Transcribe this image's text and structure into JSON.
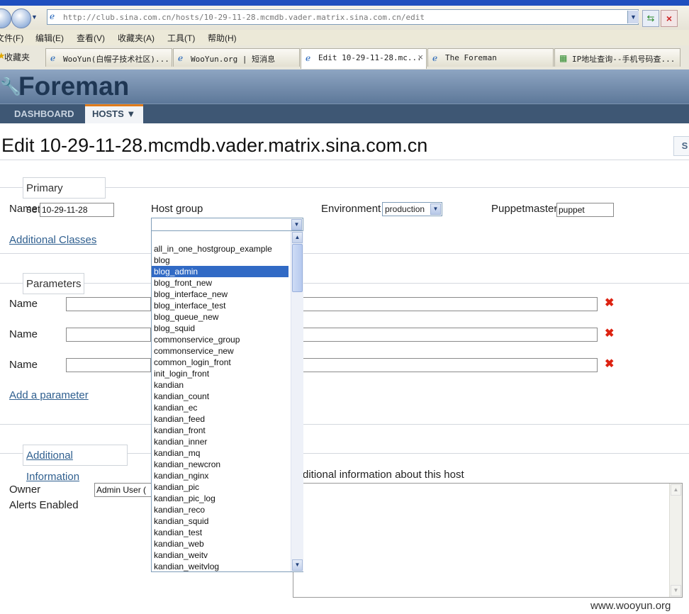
{
  "browser": {
    "address": "http://club.sina.com.cn/hosts/10-29-11-28.mcmdb.vader.matrix.sina.com.cn/edit",
    "menus": [
      "文件(F)",
      "编辑(E)",
      "查看(V)",
      "收藏夹(A)",
      "工具(T)",
      "帮助(H)"
    ],
    "favorites_label": "收藏夹",
    "tabs": [
      {
        "label": "WooYun(白帽子技术社区)..."
      },
      {
        "label": "WooYun.org | 短消息"
      },
      {
        "label": "Edit 10-29-11-28.mc..."
      },
      {
        "label": "The Foreman"
      },
      {
        "label": "IP地址查询--手机号码查..."
      }
    ]
  },
  "app": {
    "brand": "Foreman",
    "nav": [
      {
        "label": "DASHBOARD"
      },
      {
        "label": "HOSTS ▼"
      }
    ]
  },
  "page": {
    "title": "Edit 10-29-11-28.mcmdb.vader.matrix.sina.com.cn",
    "top_right_button": "S"
  },
  "primary": {
    "legend": "Primary settings",
    "name_label": "Name",
    "name_value": "10-29-11-28",
    "hostgroup_label": "Host group",
    "hostgroup_value": "",
    "environment_label": "Environment",
    "environment_value": "production",
    "puppetmaster_label": "Puppetmaster",
    "puppetmaster_value": "puppet",
    "additional_classes": "Additional Classes"
  },
  "parameters": {
    "legend": "Parameters",
    "rows": [
      {
        "label": "Name"
      },
      {
        "label": "Name"
      },
      {
        "label": "Name"
      }
    ],
    "add": "Add a parameter"
  },
  "additional": {
    "legend": "Additional Information",
    "owner_label": "Owner",
    "owner_value": "Admin User (",
    "alerts_label": "Alerts Enabled",
    "comment_label": "ditional information about this host"
  },
  "hostgroup_options": [
    "all_in_one_hostgroup_example",
    "blog",
    "blog_admin",
    "blog_front_new",
    "blog_interface_new",
    "blog_interface_test",
    "blog_queue_new",
    "blog_squid",
    "commonservice_group",
    "commonservice_new",
    "common_login_front",
    "init_login_front",
    "kandian",
    "kandian_count",
    "kandian_ec",
    "kandian_feed",
    "kandian_front",
    "kandian_inner",
    "kandian_mq",
    "kandian_newcron",
    "kandian_nginx",
    "kandian_pic",
    "kandian_pic_log",
    "kandian_reco",
    "kandian_squid",
    "kandian_test",
    "kandian_web",
    "kandian_weitv",
    "kandian_weitvlog"
  ],
  "hostgroup_selected": "blog_admin",
  "watermark": "www.wooyun.org"
}
